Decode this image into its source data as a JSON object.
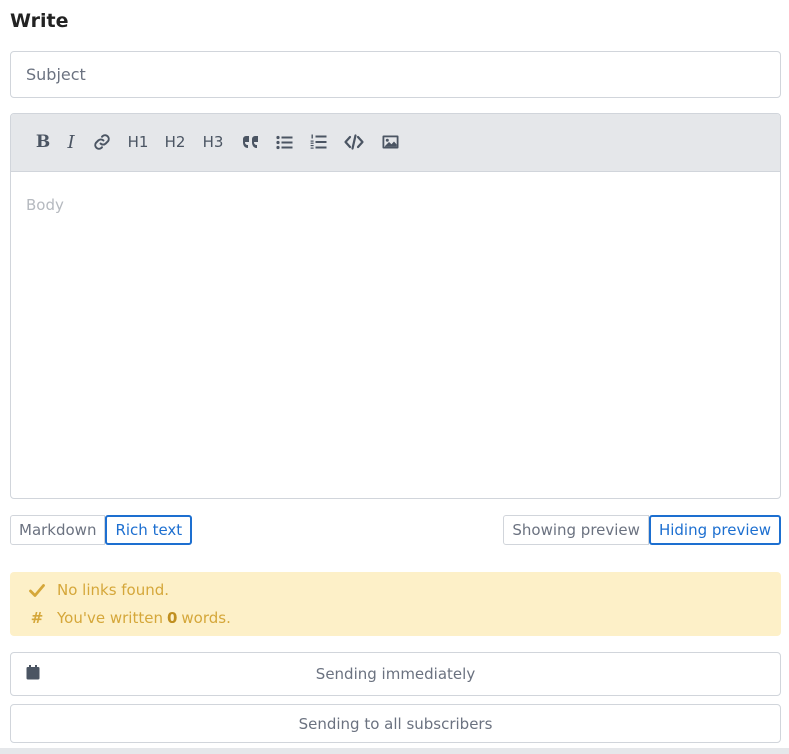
{
  "heading": "Write",
  "subject": {
    "value": "",
    "placeholder": "Subject"
  },
  "toolbar": {
    "bold_label": "B",
    "italic_label": "I",
    "link_icon": "link-icon",
    "h1_label": "H1",
    "h2_label": "H2",
    "h3_label": "H3",
    "quote_icon": "quote-icon",
    "bullet_list_icon": "bullet-list-icon",
    "numbered_list_icon": "numbered-list-icon",
    "code_icon": "code-icon",
    "image_icon": "image-icon"
  },
  "body": {
    "placeholder": "Body"
  },
  "mode_toggle": {
    "options": [
      "Markdown",
      "Rich text"
    ],
    "selected": "Rich text"
  },
  "preview_toggle": {
    "options": [
      "Showing preview",
      "Hiding preview"
    ],
    "selected": "Hiding preview"
  },
  "notice": {
    "links_text": "No links found.",
    "words_prefix": "You've written",
    "word_count": "0",
    "words_suffix": "words.",
    "check_icon": "check-icon",
    "hash_icon": "hash-icon"
  },
  "schedule": {
    "label": "Sending immediately",
    "icon": "calendar-icon"
  },
  "audience": {
    "label": "Sending to all subscribers"
  },
  "colors": {
    "accent": "#1d6fd0",
    "notice_bg": "#fdf0c8",
    "notice_text": "#d5a73a",
    "toolbar_bg": "#e5e7ea"
  }
}
